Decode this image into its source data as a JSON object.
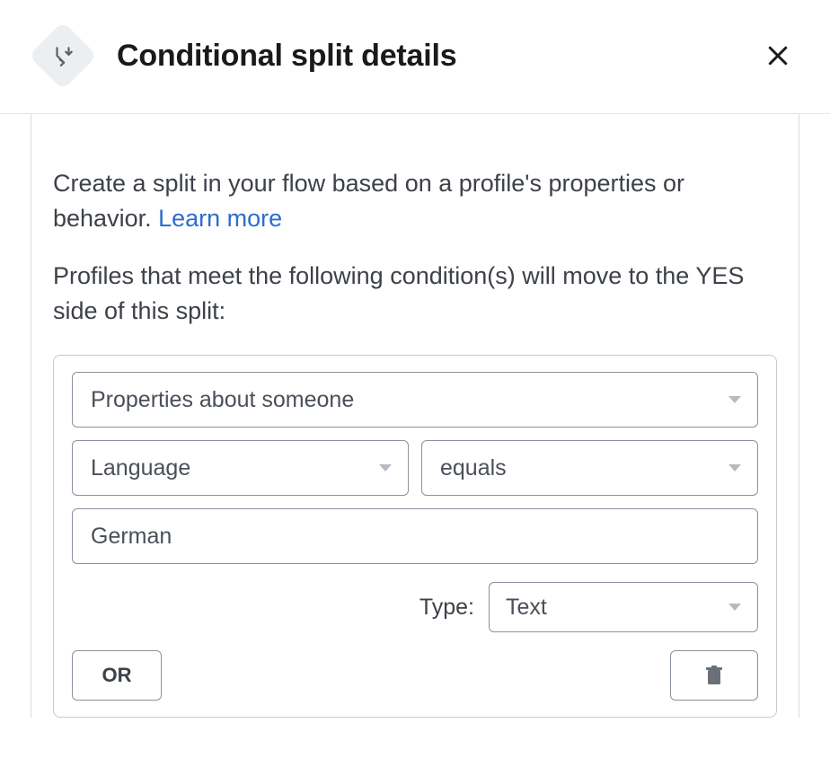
{
  "header": {
    "title": "Conditional split details"
  },
  "intro": {
    "text_before": "Create a split in your flow based on a profile's properties or behavior. ",
    "learn_more": "Learn more"
  },
  "subhead": "Profiles that meet the following condition(s) will move to the YES side of this split:",
  "condition": {
    "category_select": "Properties about someone",
    "property_select": "Language",
    "operator_select": "equals",
    "value_input": "German",
    "type_label": "Type:",
    "type_select": "Text",
    "or_button": "OR"
  }
}
